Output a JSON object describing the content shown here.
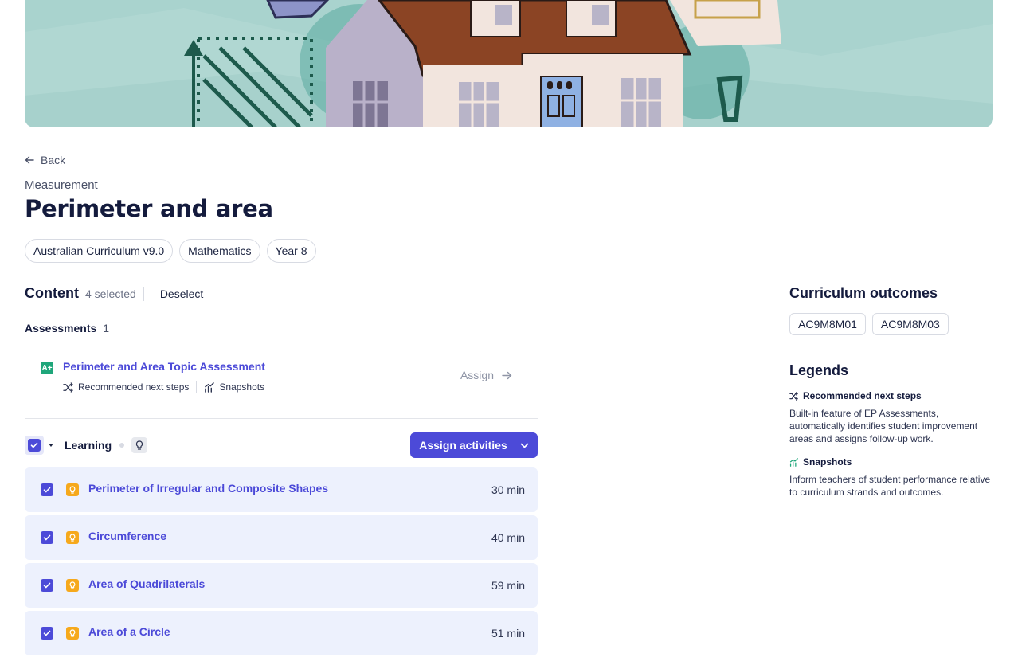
{
  "nav": {
    "back_label": "Back"
  },
  "topic": {
    "subject": "Measurement",
    "title": "Perimeter and area",
    "tags": [
      "Australian Curriculum v9.0",
      "Mathematics",
      "Year 8"
    ]
  },
  "content": {
    "title": "Content",
    "selected_text": "4 selected",
    "deselect_label": "Deselect"
  },
  "assessments": {
    "heading": "Assessments",
    "count": "1",
    "items": [
      {
        "icon": "A+",
        "title": "Perimeter and Area Topic Assessment",
        "meta": [
          "Recommended next steps",
          "Snapshots"
        ],
        "action": "Assign"
      }
    ]
  },
  "learning": {
    "label": "Learning",
    "assign_button": "Assign activities",
    "activities": [
      {
        "title": "Perimeter of Irregular and Composite Shapes",
        "duration": "30 min",
        "checked": true
      },
      {
        "title": "Circumference",
        "duration": "40 min",
        "checked": true
      },
      {
        "title": "Area of Quadrilaterals",
        "duration": "59 min",
        "checked": true
      },
      {
        "title": "Area of a Circle",
        "duration": "51 min",
        "checked": true
      }
    ]
  },
  "sidebar": {
    "outcomes_heading": "Curriculum outcomes",
    "outcomes": [
      "AC9M8M01",
      "AC9M8M03"
    ],
    "legends_heading": "Legends",
    "legends": [
      {
        "icon": "shuffle-icon",
        "title": "Recommended next steps",
        "description": "Built-in feature of EP Assessments, automatically identifies student improvement areas and assigns follow-up work."
      },
      {
        "icon": "snapshot-chart-icon",
        "title": "Snapshots",
        "description": "Inform teachers of student performance relative to curriculum strands and outcomes."
      }
    ]
  },
  "colors": {
    "accent": "#4c4ad8",
    "activity_bg": "#edf1fd",
    "assessment_icon": "#1fa67a",
    "learning_icon": "#f6a91c",
    "banner_bg": "#a9d3ce"
  }
}
